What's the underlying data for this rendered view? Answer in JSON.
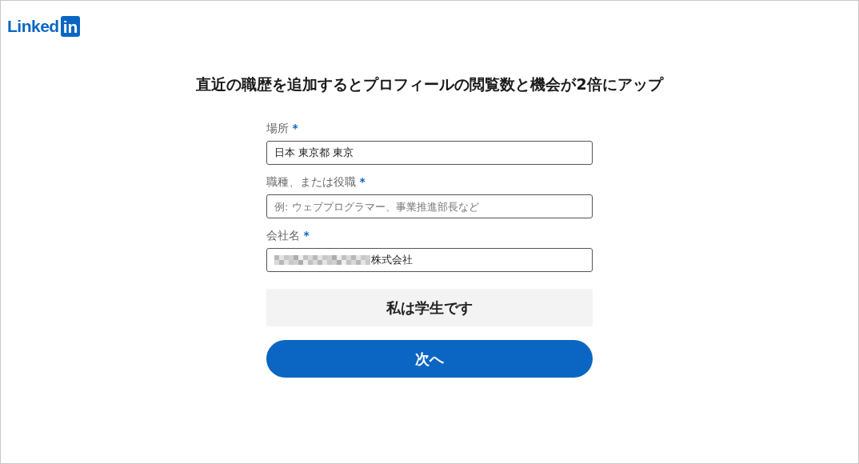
{
  "logo": {
    "word": "Linked",
    "badge": "in"
  },
  "heading": "直近の職歴を追加するとプロフィールの閲覧数と機会が2倍にアップ",
  "fields": [
    {
      "label": "場所",
      "required": "*",
      "value": "日本 東京都 東京",
      "redacted": false
    },
    {
      "label": "職種、または役職",
      "required": "*",
      "placeholder": "例: ウェブプログラマー、事業推進部長など",
      "redacted": false
    },
    {
      "label": "会社名",
      "required": "*",
      "value": "株式会社",
      "redacted": true
    }
  ],
  "buttons": [
    {
      "label": "私は学生です",
      "kind": "secondary"
    },
    {
      "label": "次へ",
      "kind": "primary"
    }
  ]
}
